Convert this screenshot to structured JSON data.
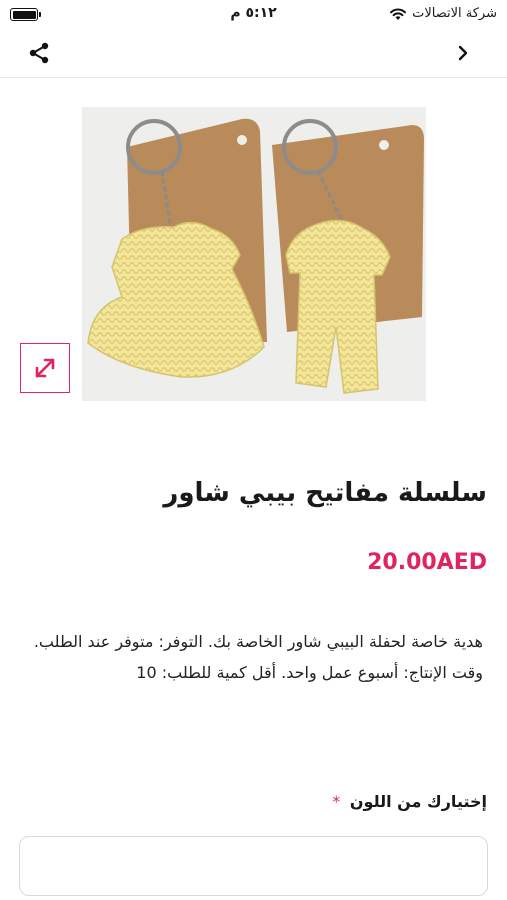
{
  "status_bar": {
    "carrier": "شركة الاتصالات",
    "time": "٥:١٢ م",
    "battery_level": 1.0
  },
  "nav": {
    "share_icon": "share-icon",
    "back_icon": "chevron-right-icon"
  },
  "product": {
    "image_alt_icon": "product-photo",
    "expand_icon": "expand-icon",
    "title": "سلسلة مفاتيح بيبي شاور",
    "price": "20.00AED",
    "description": "هدية خاصة لحفلة البيبي شاور الخاصة بك. التوفر: متوفر عند الطلب. وقت الإنتاج: أسبوع عمل واحد. أقل كمية للطلب: 10"
  },
  "options": {
    "color_label": "إختيارك من اللون",
    "required_mark": "*",
    "color_value": ""
  },
  "colors": {
    "accent": "#e0245e",
    "yarn": "#f3e59a",
    "tag": "#b98a5a"
  }
}
